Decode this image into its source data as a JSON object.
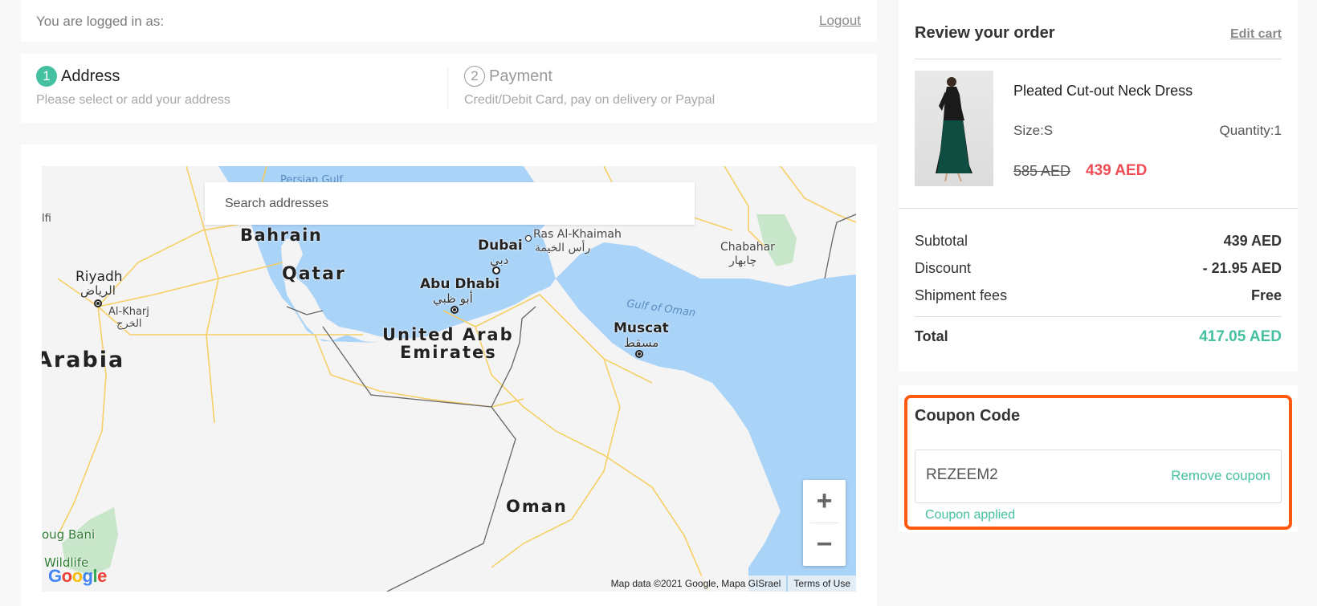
{
  "login_bar": {
    "logged_in_text": "You are logged in as:",
    "logout_label": "Logout"
  },
  "steps": [
    {
      "number": "1",
      "title": "Address",
      "description": "Please select or add your address",
      "state": "active"
    },
    {
      "number": "2",
      "title": "Payment",
      "description": "Credit/Debit Card, pay on delivery or Paypal",
      "state": "inactive"
    }
  ],
  "map": {
    "search_placeholder": "Search addresses",
    "labels": {
      "persian_gulf": "Persian Gulf",
      "bahrain": "Bahrain",
      "qatar": "Qatar",
      "riyadh": "Riyadh",
      "riyadh_ar": "الرياض",
      "al_kharj": "Al-Kharj",
      "al_kharj_ar": "الخرج",
      "arabia": "Arabia",
      "dubai": "Dubai",
      "dubai_ar": "دبي",
      "ras_al_khaimah": "Ras Al-Khaimah",
      "ras_al_khaimah_ar": "رأس الخيمة",
      "abu_dhabi": "Abu Dhabi",
      "abu_dhabi_ar": "أبو ظبي",
      "uae_line1": "United Arab",
      "uae_line2": "Emirates",
      "muscat": "Muscat",
      "muscat_ar": "مسقط",
      "gulf_of_oman": "Gulf of Oman",
      "chabahar": "Chabahar",
      "chabahar_ar": "چابهار",
      "oman": "Oman",
      "afif_fragment": "lfi",
      "wildlife_line1": "oug Bani",
      "wildlife_line2": "Wildlife"
    },
    "zoom_in_label": "+",
    "zoom_out_label": "−",
    "attribution": "Map data ©2021 Google, Mapa GISrael",
    "terms_label": "Terms of Use",
    "logo_letters": [
      "G",
      "o",
      "o",
      "g",
      "l",
      "e"
    ]
  },
  "review": {
    "title": "Review your order",
    "edit_cart_label": "Edit cart",
    "product": {
      "name": "Pleated Cut-out Neck Dress",
      "size": "Size:S",
      "quantity": "Quantity:1",
      "old_price": "585 AED",
      "new_price": "439 AED"
    },
    "summary": [
      {
        "label": "Subtotal",
        "value": "439 AED"
      },
      {
        "label": "Discount",
        "value": "- 21.95 AED"
      },
      {
        "label": "Shipment fees",
        "value": "Free"
      }
    ],
    "total": {
      "label": "Total",
      "value": "417.05 AED"
    }
  },
  "coupon": {
    "title": "Coupon Code",
    "code": "REZEEM2",
    "remove_label": "Remove coupon",
    "status": "Coupon applied"
  },
  "colors": {
    "accent": "#45c0a0",
    "sale_price": "#ef4d56",
    "highlight_border": "#ff5a0f",
    "water": "#aad3f8"
  }
}
